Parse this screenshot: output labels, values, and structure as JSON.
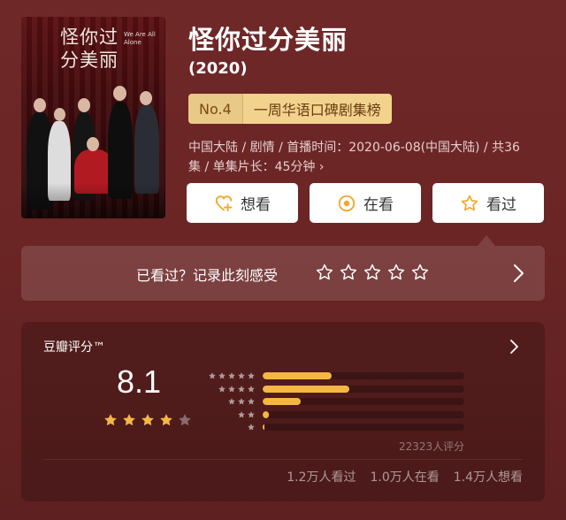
{
  "poster": {
    "title_cn": "怪你过分美丽",
    "title_en": "We Are All Alone"
  },
  "header": {
    "title": "怪你过分美丽",
    "year": "(2020)",
    "rank_no": "No.4",
    "rank_list": "一周华语口碑剧集榜",
    "info_line1": "中国大陆 / 剧情 / 首播时间：2020-06-08(中国大陆) / 共36",
    "info_line2": "集 / 单集片长：45分钟 ›"
  },
  "actions": {
    "want_label": "想看",
    "watching_label": "在看",
    "watched_label": "看过"
  },
  "rate_prompt": {
    "text": "已看过？记录此刻感受"
  },
  "score": {
    "label": "豆瓣评分™",
    "value": "8.1",
    "stars_filled": 4,
    "distribution": [
      {
        "stars": 5,
        "fraction": 0.34
      },
      {
        "stars": 4,
        "fraction": 0.43
      },
      {
        "stars": 3,
        "fraction": 0.19
      },
      {
        "stars": 2,
        "fraction": 0.03
      },
      {
        "stars": 1,
        "fraction": 0.01
      }
    ],
    "count_text": "22323人评分",
    "watched_text": "1.2万人看过",
    "watching_text": "1.0万人在看",
    "want_text": "1.4万人想看"
  },
  "colors": {
    "accent": "#f5b742",
    "background": "#6e2626",
    "button_icon": "#f0a72a"
  }
}
